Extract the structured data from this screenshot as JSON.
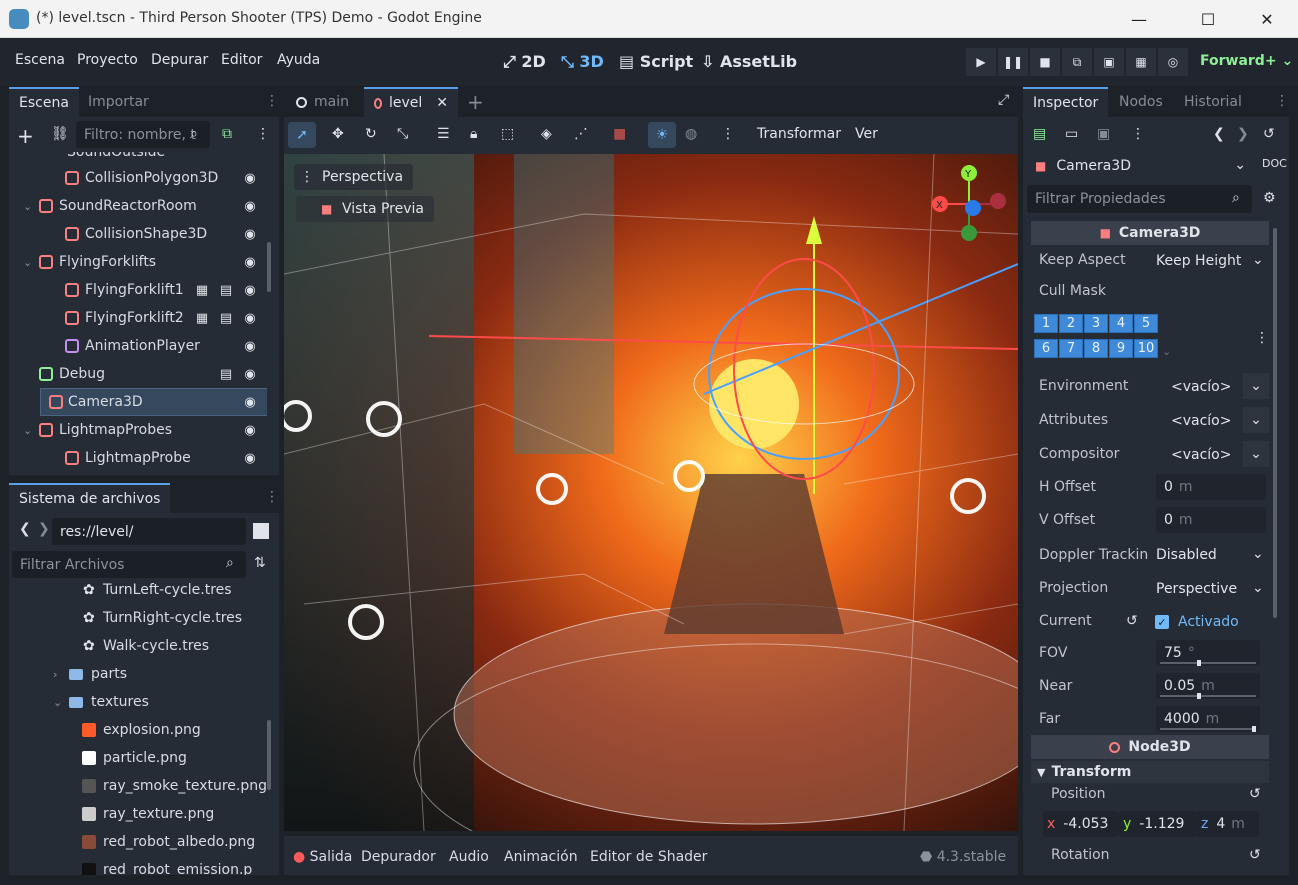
{
  "window": {
    "title": "(*) level.tscn - Third Person Shooter (TPS) Demo - Godot Engine"
  },
  "menu": {
    "items": [
      "Escena",
      "Proyecto",
      "Depurar",
      "Editor",
      "Ayuda"
    ]
  },
  "workspaces": {
    "items": [
      "2D",
      "3D",
      "Script",
      "AssetLib"
    ],
    "active": "3D"
  },
  "renderer": "Forward+",
  "scene_dock": {
    "tabs": [
      "Escena",
      "Importar"
    ],
    "filter_placeholder": "Filtro: nombre, t",
    "partial_top": "SoundOutside",
    "nodes": [
      {
        "label": "CollisionPolygon3D",
        "depth": 2,
        "icon": "collision-polygon-icon",
        "color": "#fc7f7f"
      },
      {
        "label": "SoundReactorRoom",
        "depth": 1,
        "icon": "audio-player-icon",
        "color": "#fc7f7f",
        "expand": true
      },
      {
        "label": "CollisionShape3D",
        "depth": 2,
        "icon": "collision-shape-icon",
        "color": "#fc7f7f"
      },
      {
        "label": "FlyingForklifts",
        "depth": 1,
        "icon": "node3d-icon",
        "color": "#fc7f7f",
        "expand": true
      },
      {
        "label": "FlyingForklift1",
        "depth": 2,
        "icon": "forklift-icon",
        "color": "#fc7f7f",
        "extra": true
      },
      {
        "label": "FlyingForklift2",
        "depth": 2,
        "icon": "forklift-icon",
        "color": "#fc7f7f",
        "extra": true
      },
      {
        "label": "AnimationPlayer",
        "depth": 2,
        "icon": "animation-player-icon",
        "color": "#c38ef1"
      },
      {
        "label": "Debug",
        "depth": 1,
        "icon": "control-label-icon",
        "color": "#8eef97",
        "script": true
      },
      {
        "label": "Camera3D",
        "depth": 1,
        "icon": "camera-icon",
        "color": "#fc7f7f",
        "selected": true
      },
      {
        "label": "LightmapProbes",
        "depth": 1,
        "icon": "node3d-icon",
        "color": "#fc7f7f",
        "expand": true
      },
      {
        "label": "LightmapProbe",
        "depth": 2,
        "icon": "lightmap-probe-icon",
        "color": "#fc7f7f"
      }
    ]
  },
  "filesystem": {
    "title": "Sistema de archivos",
    "path": "res://level/",
    "filter_placeholder": "Filtrar Archivos",
    "items": [
      {
        "label": "TurnLeft-cycle.tres",
        "depth": 3,
        "type": "res"
      },
      {
        "label": "TurnRight-cycle.tres",
        "depth": 3,
        "type": "res"
      },
      {
        "label": "Walk-cycle.tres",
        "depth": 3,
        "type": "res"
      },
      {
        "label": "parts",
        "depth": 2,
        "type": "folder",
        "expand": "right"
      },
      {
        "label": "textures",
        "depth": 2,
        "type": "folder",
        "expand": "down"
      },
      {
        "label": "explosion.png",
        "depth": 3,
        "type": "img",
        "color": "#ff5a2a"
      },
      {
        "label": "particle.png",
        "depth": 3,
        "type": "img",
        "color": "#ffffff"
      },
      {
        "label": "ray_smoke_texture.png",
        "depth": 3,
        "type": "img",
        "color": "#555555"
      },
      {
        "label": "ray_texture.png",
        "depth": 3,
        "type": "img",
        "color": "#cccccc"
      },
      {
        "label": "red_robot_albedo.png",
        "depth": 3,
        "type": "img",
        "color": "#8a4a3a"
      },
      {
        "label": "red_robot_emission.p",
        "depth": 3,
        "type": "img",
        "color": "#111111"
      }
    ]
  },
  "editor_tabs": [
    {
      "label": "main",
      "active": false
    },
    {
      "label": "level",
      "active": true
    }
  ],
  "viewport_toolbar": {
    "transform": "Transformar",
    "view": "Ver"
  },
  "viewport": {
    "perspective": "Perspectiva",
    "preview": "Vista Previa",
    "gizmo_axes": [
      "X",
      "Y",
      "Z"
    ]
  },
  "bottom_panel": {
    "tabs": [
      "Salida",
      "Depurador",
      "Audio",
      "Animación",
      "Editor de Shader"
    ],
    "version": "4.3.stable"
  },
  "inspector": {
    "tabs": [
      "Inspector",
      "Nodos",
      "Historial"
    ],
    "node": "Camera3D",
    "filter_placeholder": "Filtrar Propiedades",
    "section_camera": "Camera3D",
    "props": {
      "keep_aspect": {
        "label": "Keep Aspect",
        "value": "Keep Height"
      },
      "cull_mask": {
        "label": "Cull Mask",
        "bits": [
          "1",
          "2",
          "3",
          "4",
          "5",
          "6",
          "7",
          "8",
          "9",
          "10"
        ]
      },
      "environment": {
        "label": "Environment",
        "value": "<vacío>"
      },
      "attributes": {
        "label": "Attributes",
        "value": "<vacío>"
      },
      "compositor": {
        "label": "Compositor",
        "value": "<vacío>"
      },
      "h_offset": {
        "label": "H Offset",
        "value": "0",
        "unit": "m"
      },
      "v_offset": {
        "label": "V Offset",
        "value": "0",
        "unit": "m"
      },
      "doppler": {
        "label": "Doppler Trackin",
        "value": "Disabled"
      },
      "projection": {
        "label": "Projection",
        "value": "Perspective"
      },
      "current": {
        "label": "Current",
        "value": "Activado"
      },
      "fov": {
        "label": "FOV",
        "value": "75",
        "unit": "°",
        "fraction": 0.4
      },
      "near": {
        "label": "Near",
        "value": "0.05",
        "unit": "m",
        "fraction": 0.4
      },
      "far": {
        "label": "Far",
        "value": "4000",
        "unit": "m",
        "fraction": 1.0
      }
    },
    "section_node3d": "Node3D",
    "transform": "Transform",
    "position_label": "Position",
    "position": {
      "x": "-4.053",
      "y": "-1.129",
      "z": "4",
      "unit": "m"
    },
    "rotation_label": "Rotation"
  },
  "colors": {
    "accent": "#70bafa",
    "node3d": "#fc7f7f",
    "selected": "#35485e"
  }
}
